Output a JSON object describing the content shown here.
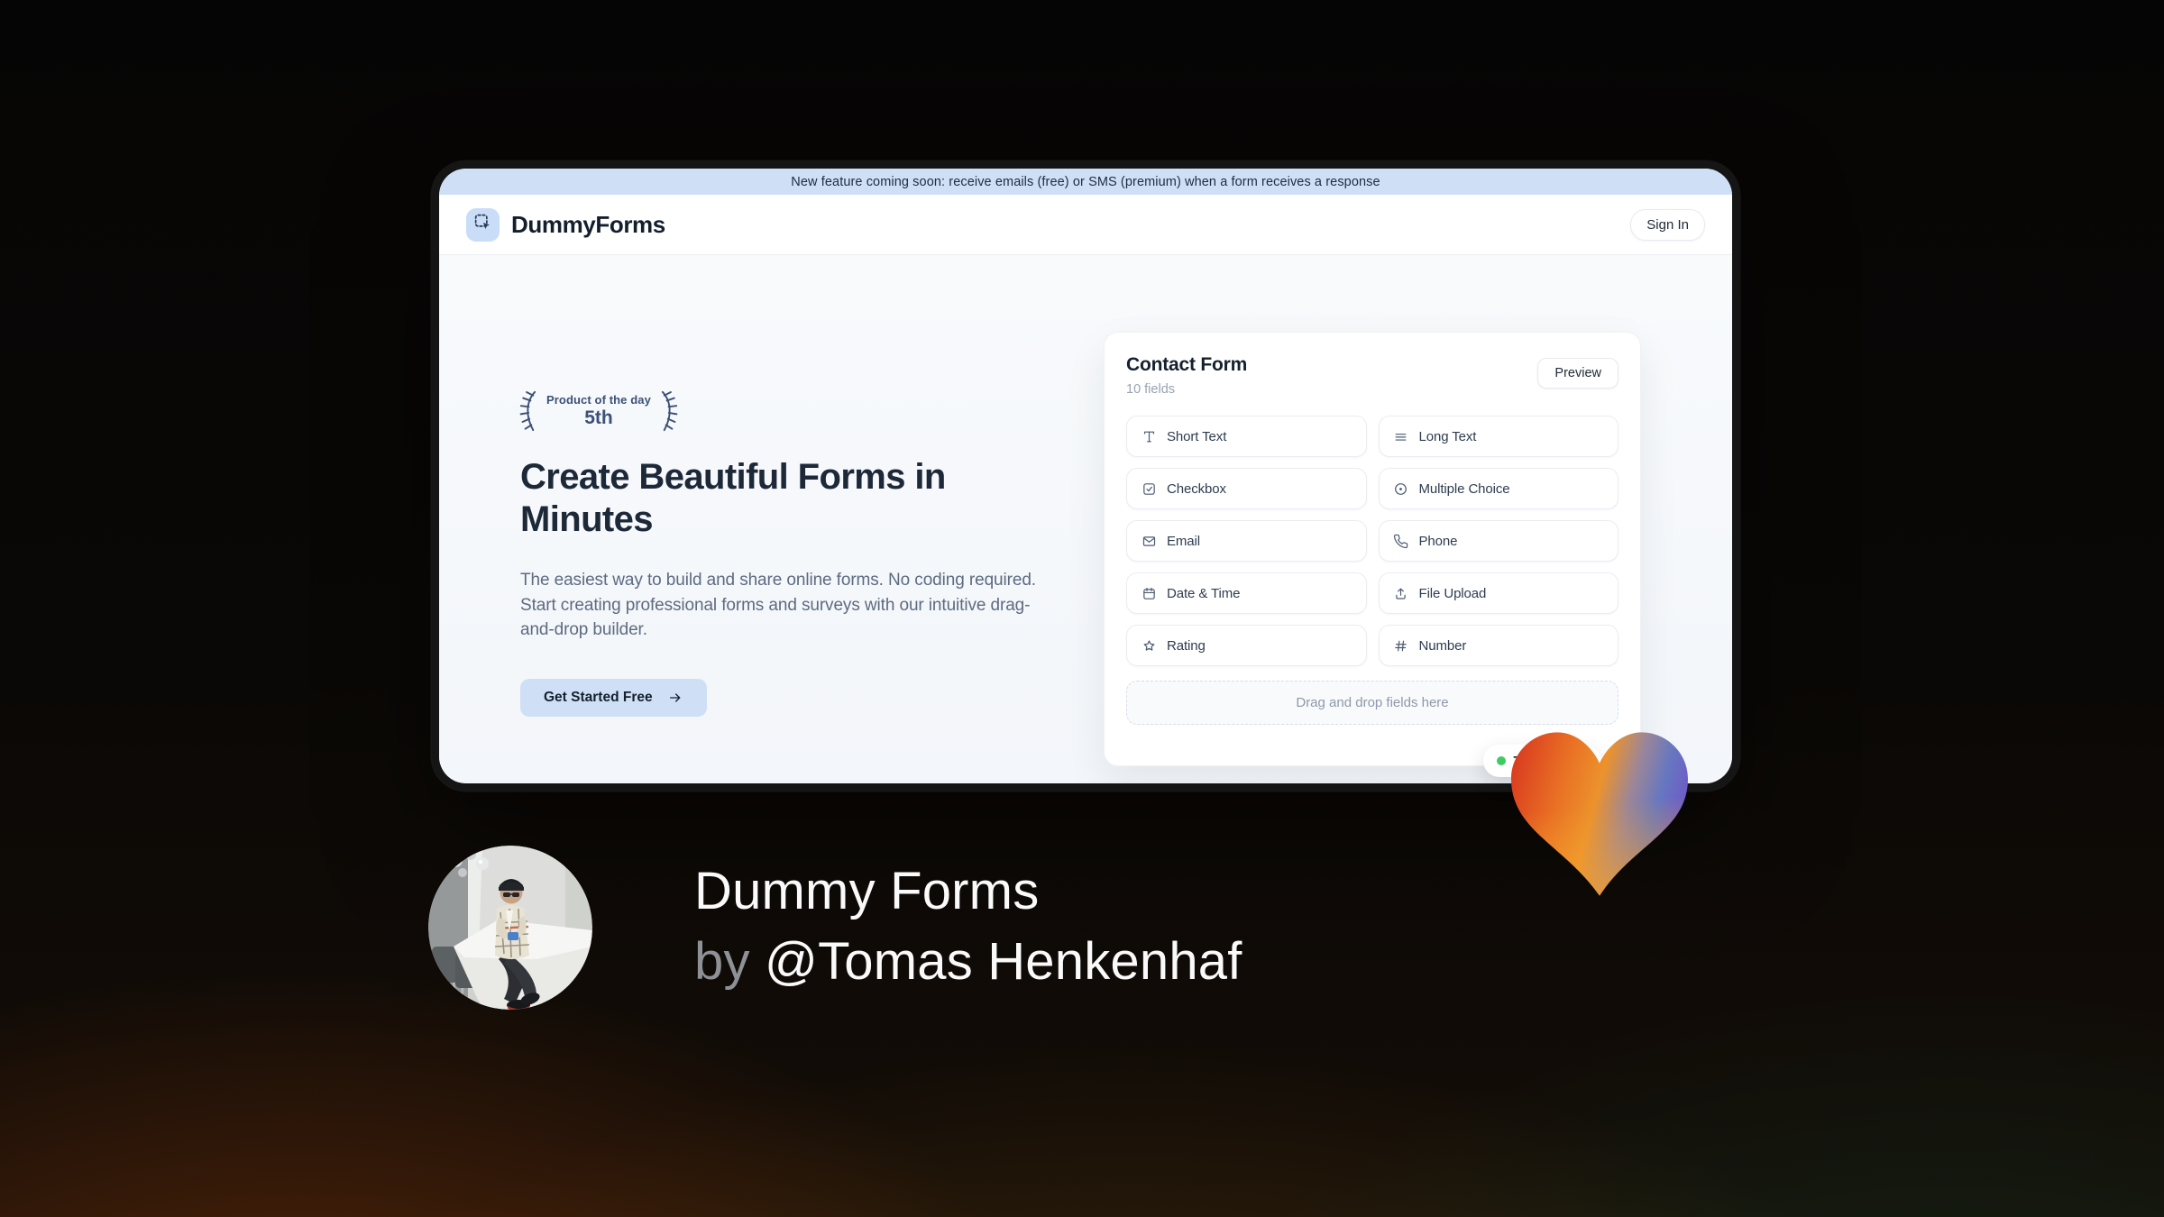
{
  "banner": {
    "text": "New feature coming soon: receive emails (free) or SMS (premium) when a form receives a response"
  },
  "header": {
    "brand": "DummyForms",
    "logo_icon": "dashed-selection-cursor-icon",
    "sign_in_label": "Sign In"
  },
  "hero": {
    "award_badge": {
      "top_label": "Product of the day",
      "rank": "5th",
      "laurel_icon": "laurel-branch-icon"
    },
    "heading": "Create Beautiful Forms in Minutes",
    "subheading": "The easiest way to build and share online forms. No coding required. Start creating professional forms and surveys with our intuitive drag-and-drop builder.",
    "cta_label": "Get Started Free",
    "cta_icon": "arrow-right-icon"
  },
  "form_card": {
    "title": "Contact Form",
    "subtitle": "10 fields",
    "preview_label": "Preview",
    "fields": [
      {
        "icon": "short-text-icon",
        "label": "Short Text"
      },
      {
        "icon": "long-text-icon",
        "label": "Long Text"
      },
      {
        "icon": "checkbox-icon",
        "label": "Checkbox"
      },
      {
        "icon": "multiple-choice-icon",
        "label": "Multiple Choice"
      },
      {
        "icon": "email-icon",
        "label": "Email"
      },
      {
        "icon": "phone-icon",
        "label": "Phone"
      },
      {
        "icon": "date-time-icon",
        "label": "Date & Time"
      },
      {
        "icon": "file-upload-icon",
        "label": "File Upload"
      },
      {
        "icon": "rating-icon",
        "label": "Rating"
      },
      {
        "icon": "number-icon",
        "label": "Number"
      }
    ],
    "dropzone_text": "Drag and drop fields here",
    "status_pill": {
      "visible_text": "7",
      "dot_color": "#3ecb63"
    }
  },
  "caption": {
    "line1": "Dummy Forms",
    "by": "by",
    "author": "@Tomas Henkenhaf"
  },
  "decor": {
    "heart_icon": "gradient-heart-icon",
    "avatar": "author-photo-avatar"
  },
  "colors": {
    "accent_blue": "#cfe0f6",
    "navy": "#1b2637",
    "status_green": "#3ecb63",
    "banner_bg": "#cfe0f6"
  }
}
